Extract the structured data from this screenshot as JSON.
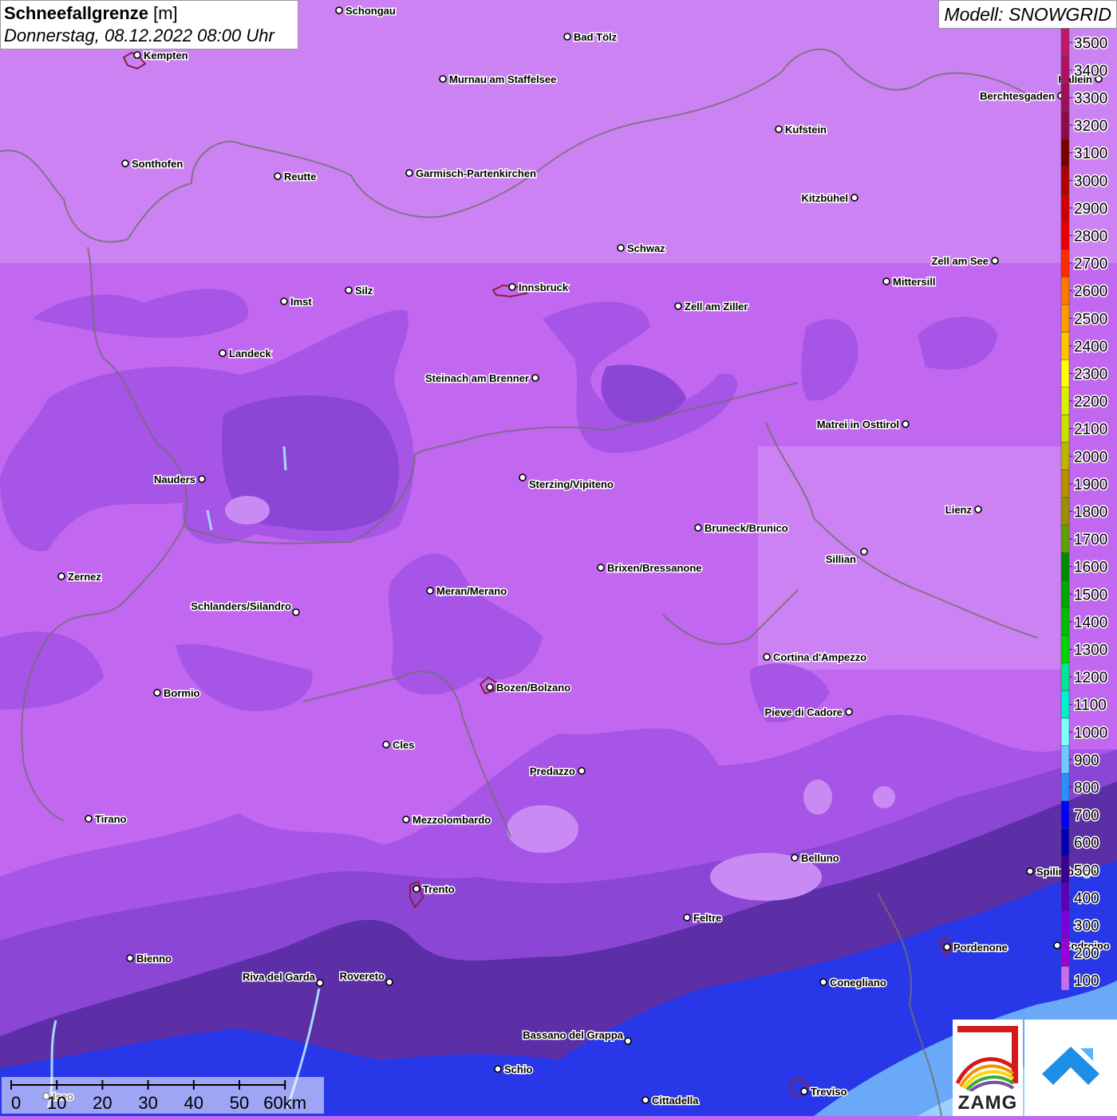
{
  "title": {
    "main": "Schneefallgrenze",
    "unit": "[m]",
    "datetime": "Donnerstag, 08.12.2022 08:00 Uhr"
  },
  "model_label": "Modell: SNOWGRID",
  "legend": {
    "levels": [
      {
        "value": "3500",
        "color": "#c2176c"
      },
      {
        "value": "3400",
        "color": "#b0125f"
      },
      {
        "value": "3300",
        "color": "#9e0e5a"
      },
      {
        "value": "3200",
        "color": "#8c0a4a"
      },
      {
        "value": "3100",
        "color": "#7a0000"
      },
      {
        "value": "3000",
        "color": "#b00000"
      },
      {
        "value": "2900",
        "color": "#d20000"
      },
      {
        "value": "2800",
        "color": "#ea0000"
      },
      {
        "value": "2700",
        "color": "#ff2a00"
      },
      {
        "value": "2600",
        "color": "#ff7a00"
      },
      {
        "value": "2500",
        "color": "#ff9c00"
      },
      {
        "value": "2400",
        "color": "#ffc400"
      },
      {
        "value": "2300",
        "color": "#ffff00"
      },
      {
        "value": "2200",
        "color": "#d8f000"
      },
      {
        "value": "2100",
        "color": "#c8e000"
      },
      {
        "value": "2000",
        "color": "#c0b400"
      },
      {
        "value": "1900",
        "color": "#b89000"
      },
      {
        "value": "1800",
        "color": "#9a9000"
      },
      {
        "value": "1700",
        "color": "#60a000"
      },
      {
        "value": "1600",
        "color": "#008c00"
      },
      {
        "value": "1500",
        "color": "#00a800"
      },
      {
        "value": "1400",
        "color": "#00c000"
      },
      {
        "value": "1300",
        "color": "#00d800"
      },
      {
        "value": "1200",
        "color": "#00e890"
      },
      {
        "value": "1100",
        "color": "#00f0d0"
      },
      {
        "value": "1000",
        "color": "#80ffff"
      },
      {
        "value": "900",
        "color": "#70c8ff"
      },
      {
        "value": "800",
        "color": "#2890ff"
      },
      {
        "value": "700",
        "color": "#0000ff"
      },
      {
        "value": "600",
        "color": "#0000b0"
      },
      {
        "value": "500",
        "color": "#3a0090"
      },
      {
        "value": "400",
        "color": "#5a00b8"
      },
      {
        "value": "300",
        "color": "#7a00e0"
      },
      {
        "value": "200",
        "color": "#a000d8"
      },
      {
        "value": "100",
        "color": "#c86cf5"
      }
    ]
  },
  "cities": [
    {
      "name": "Schongau"
    },
    {
      "name": "Bad Tölz"
    },
    {
      "name": "Kempten"
    },
    {
      "name": "Murnau am Staffelsee"
    },
    {
      "name": "Hallein"
    },
    {
      "name": "Berchtesgaden"
    },
    {
      "name": "Kufstein"
    },
    {
      "name": "Sonthofen"
    },
    {
      "name": "Reutte"
    },
    {
      "name": "Garmisch-Partenkirchen"
    },
    {
      "name": "Kitzbühel"
    },
    {
      "name": "Schwaz"
    },
    {
      "name": "Zell am See"
    },
    {
      "name": "Innsbruck"
    },
    {
      "name": "Mittersill"
    },
    {
      "name": "Imst"
    },
    {
      "name": "Silz"
    },
    {
      "name": "Zell am Ziller"
    },
    {
      "name": "Landeck"
    },
    {
      "name": "Steinach am Brenner"
    },
    {
      "name": "Matrei in Osttirol"
    },
    {
      "name": "Nauders"
    },
    {
      "name": "Sterzing/Vipiteno"
    },
    {
      "name": "Lienz"
    },
    {
      "name": "Bruneck/Brunico"
    },
    {
      "name": "Sillian"
    },
    {
      "name": "Zernez"
    },
    {
      "name": "Brixen/Bressanone"
    },
    {
      "name": "Meran/Merano"
    },
    {
      "name": "Schlanders/Silandro"
    },
    {
      "name": "Cortina d'Ampezzo"
    },
    {
      "name": "Bozen/Bolzano"
    },
    {
      "name": "Bormio"
    },
    {
      "name": "Pieve di Cadore"
    },
    {
      "name": "Cles"
    },
    {
      "name": "Predazzo"
    },
    {
      "name": "Tirano"
    },
    {
      "name": "Mezzolombardo"
    },
    {
      "name": "Belluno"
    },
    {
      "name": "Spilimbergo"
    },
    {
      "name": "Trento"
    },
    {
      "name": "Feltre"
    },
    {
      "name": "Pordenone"
    },
    {
      "name": "Codroipo"
    },
    {
      "name": "Bienno"
    },
    {
      "name": "Riva del Garda"
    },
    {
      "name": "Rovereto"
    },
    {
      "name": "Conegliano"
    },
    {
      "name": "Bassano del Grappa"
    },
    {
      "name": "Schio"
    },
    {
      "name": "Iseo"
    },
    {
      "name": "Treviso"
    },
    {
      "name": "Cittadella"
    }
  ],
  "scale_bar": {
    "labels": [
      "0",
      "10",
      "20",
      "30",
      "40",
      "50",
      "60km"
    ]
  },
  "logos": {
    "zamg_text": "ZAMG",
    "app_icon": "snowgrid-app-icon"
  }
}
